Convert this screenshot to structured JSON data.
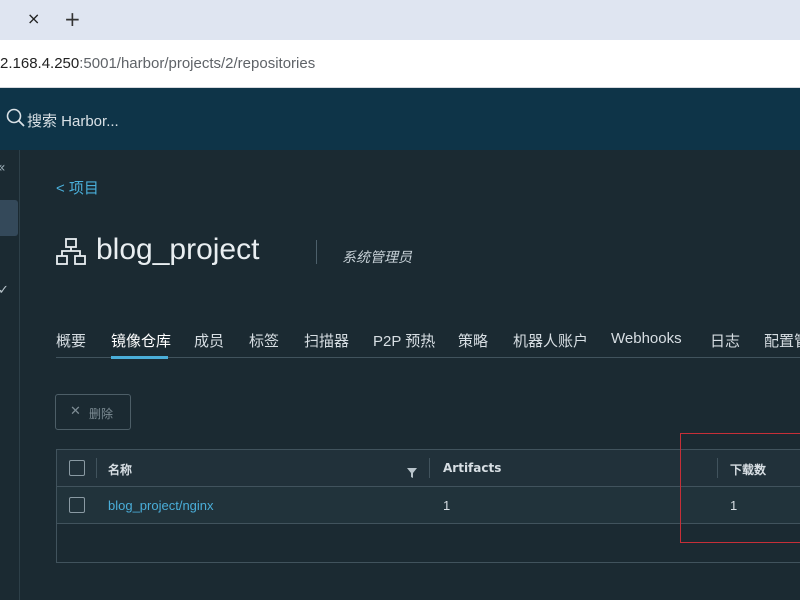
{
  "browser": {
    "tab_close_glyph": "×",
    "new_tab_glyph": "+",
    "url_host": "2.168.4.250",
    "url_rest": ":5001/harbor/projects/2/repositories"
  },
  "header": {
    "search_placeholder": "搜索 Harbor..."
  },
  "sidebar": {
    "collapse_glyph": "«",
    "check_glyph": "✓"
  },
  "project": {
    "back_label": "<  项目",
    "name": "blog_project",
    "role": "系统管理员"
  },
  "tabs": [
    {
      "label": "概要"
    },
    {
      "label": "镜像仓库",
      "active": true
    },
    {
      "label": "成员"
    },
    {
      "label": "标签"
    },
    {
      "label": "扫描器"
    },
    {
      "label": "P2P 预热"
    },
    {
      "label": "策略"
    },
    {
      "label": "机器人账户"
    },
    {
      "label": "Webhooks"
    },
    {
      "label": "日志"
    },
    {
      "label": "配置管"
    }
  ],
  "toolbar": {
    "delete_label": "删除",
    "delete_glyph": "✕"
  },
  "table": {
    "columns": [
      "名称",
      "Artifacts",
      "下载数"
    ],
    "rows": [
      {
        "name": "blog_project/nginx",
        "artifacts": "1",
        "pulls": "1"
      }
    ]
  },
  "colors": {
    "accent": "#4aaed9",
    "header_bg": "#0e3448",
    "page_bg": "#1b2a32",
    "highlight": "#c62f38"
  }
}
